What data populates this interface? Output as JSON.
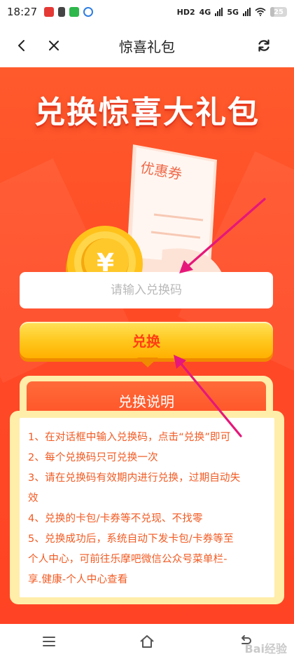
{
  "status_bar": {
    "time": "18:27",
    "right_badges": [
      "HD2",
      "4G",
      "5G"
    ],
    "battery": "25",
    "battery_level": 0.25
  },
  "nav": {
    "title": "惊喜礼包"
  },
  "banner": {
    "title": "兑换惊喜大礼包",
    "coupon_text": "优惠券",
    "coin_symbol": "¥"
  },
  "form": {
    "code_placeholder": "请输入兑换码",
    "code_value": "",
    "redeem_label": "兑换"
  },
  "instructions": {
    "header": "兑换说明",
    "lines": [
      "1、在对话框中输入兑换码，点击“兑换”即可",
      "2、每个兑换码只可兑换一次",
      "3、请在兑换码有效期内进行兑换，过期自动失",
      "效",
      "4、兑换的卡包/卡券等不兑现、不找零",
      "5、兑换成功后，系统自动下发卡包/卡券等至",
      "个人中心，可前往乐摩吧微信公众号菜单栏-",
      "享.健康-个人中心查看"
    ]
  },
  "watermark": "Bai经验",
  "colors": {
    "primary_red": "#ff4a26",
    "button_yellow": "#ffc61b",
    "instruction_text": "#f25a22",
    "card_border": "#ffeeaa",
    "annotation_arrow": "#e6177a"
  },
  "icons": {
    "back": "chevron-left-icon",
    "close": "close-icon",
    "refresh": "refresh-icon",
    "menu": "menu-icon",
    "home": "home-icon",
    "return": "return-icon"
  }
}
